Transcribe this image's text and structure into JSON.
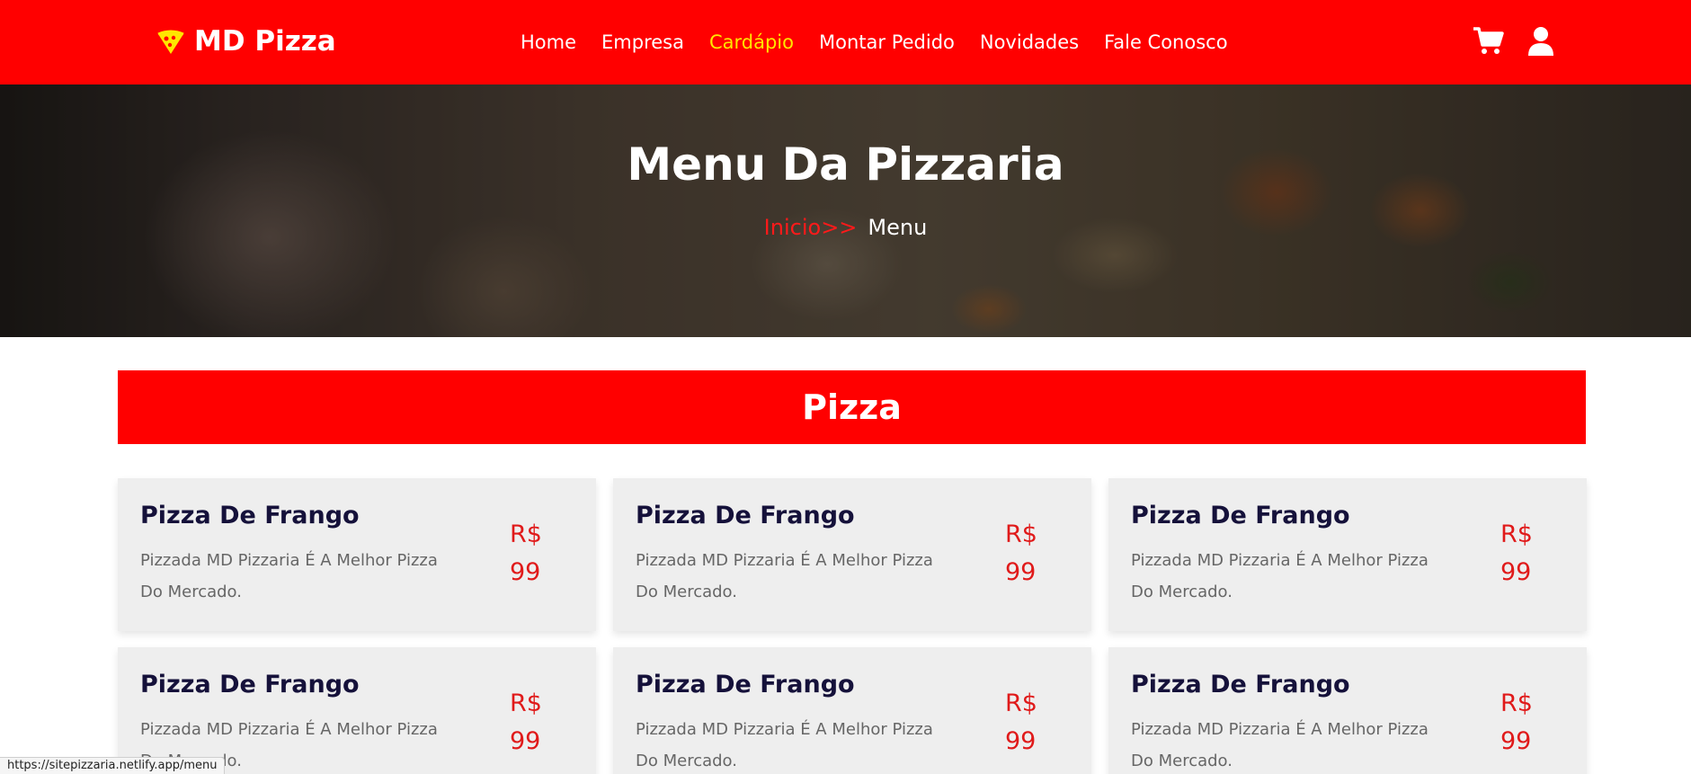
{
  "colors": {
    "brand": "#ff0000",
    "nav_active": "#ffe600",
    "price": "#e01a1a",
    "card_bg": "#eeeeee",
    "card_title": "#15113a"
  },
  "header": {
    "logo_text": "MD Pizza",
    "logo_icon": "pizza-slice-icon",
    "nav": [
      {
        "label": "Home",
        "active": false
      },
      {
        "label": "Empresa",
        "active": false
      },
      {
        "label": "Cardápio",
        "active": true
      },
      {
        "label": "Montar Pedido",
        "active": false
      },
      {
        "label": "Novidades",
        "active": false
      },
      {
        "label": "Fale Conosco",
        "active": false
      }
    ],
    "icons": [
      "cart-icon",
      "user-icon"
    ]
  },
  "hero": {
    "title": "Menu Da Pizzaria",
    "breadcrumb": {
      "link": "Inicio",
      "separator": ">>",
      "current": "Menu"
    }
  },
  "section": {
    "title": "Pizza",
    "items": [
      {
        "name": "Pizza De Frango",
        "description": "Pizzada MD Pizzaria É A Melhor Pizza Do Mercado.",
        "currency": "R$",
        "price": "99"
      },
      {
        "name": "Pizza De Frango",
        "description": "Pizzada MD Pizzaria É A Melhor Pizza Do Mercado.",
        "currency": "R$",
        "price": "99"
      },
      {
        "name": "Pizza De Frango",
        "description": "Pizzada MD Pizzaria É A Melhor Pizza Do Mercado.",
        "currency": "R$",
        "price": "99"
      },
      {
        "name": "Pizza De Frango",
        "description": "Pizzada MD Pizzaria É A Melhor Pizza Do Mercado.",
        "currency": "R$",
        "price": "99"
      },
      {
        "name": "Pizza De Frango",
        "description": "Pizzada MD Pizzaria É A Melhor Pizza Do Mercado.",
        "currency": "R$",
        "price": "99"
      },
      {
        "name": "Pizza De Frango",
        "description": "Pizzada MD Pizzaria É A Melhor Pizza Do Mercado.",
        "currency": "R$",
        "price": "99"
      }
    ]
  },
  "status_bar": {
    "url": "https://sitepizzaria.netlify.app/menu"
  }
}
